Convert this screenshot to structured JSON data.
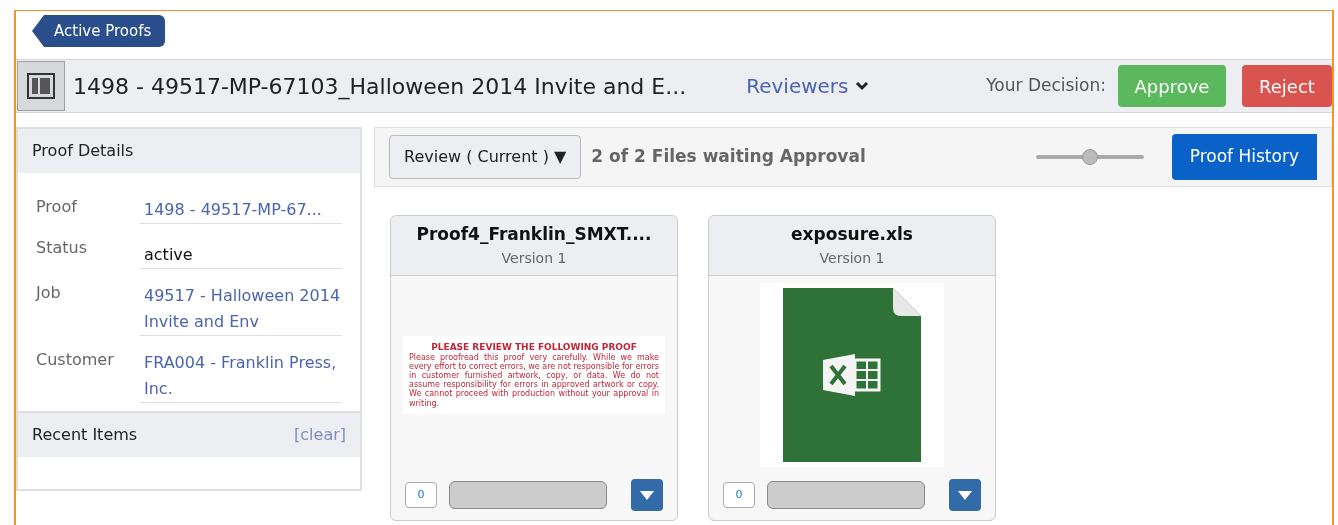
{
  "back_button": {
    "label": "Active Proofs"
  },
  "header": {
    "title": "1498 - 49517-MP-67103_Halloween 2014 Invite and E...",
    "reviewers": "Reviewers",
    "decision_label": "Your Decision:",
    "approve": "Approve",
    "reject": "Reject"
  },
  "proof_details": {
    "title": "Proof Details",
    "rows": [
      {
        "label": "Proof",
        "value": "1498 - 49517-MP-67...",
        "kind": "link"
      },
      {
        "label": "Status",
        "value": "active",
        "kind": "text"
      },
      {
        "label": "Job",
        "value": "49517 - Halloween 2014 Invite and Env",
        "kind": "link"
      },
      {
        "label": "Customer",
        "value": "FRA004 - Franklin Press, Inc.",
        "kind": "link"
      }
    ]
  },
  "recent_items": {
    "title": "Recent Items",
    "clear": "[clear]"
  },
  "toolbar": {
    "review_dropdown": "Review ( Current ) ▼",
    "status": "2 of 2 Files waiting Approval",
    "zoom_slider": {
      "level": 0.5
    },
    "proof_history": "Proof History"
  },
  "files": [
    {
      "name": "Proof4_Franklin_SMXT....",
      "version": "Version 1",
      "kind": "proof",
      "preview_heading": "PLEASE REVIEW THE FOLLOWING PROOF",
      "preview_text": "Please proofread this proof very carefully. While we make every effort to correct errors, we are not responsible for errors in customer furnished artwork, copy, or data. We do not assume responsibility for errors in approved artwork or copy. We cannot proceed with production without your approval in writing.",
      "comments": "0"
    },
    {
      "name": "exposure.xls",
      "version": "Version 1",
      "kind": "spreadsheet",
      "comments": "0"
    }
  ]
}
